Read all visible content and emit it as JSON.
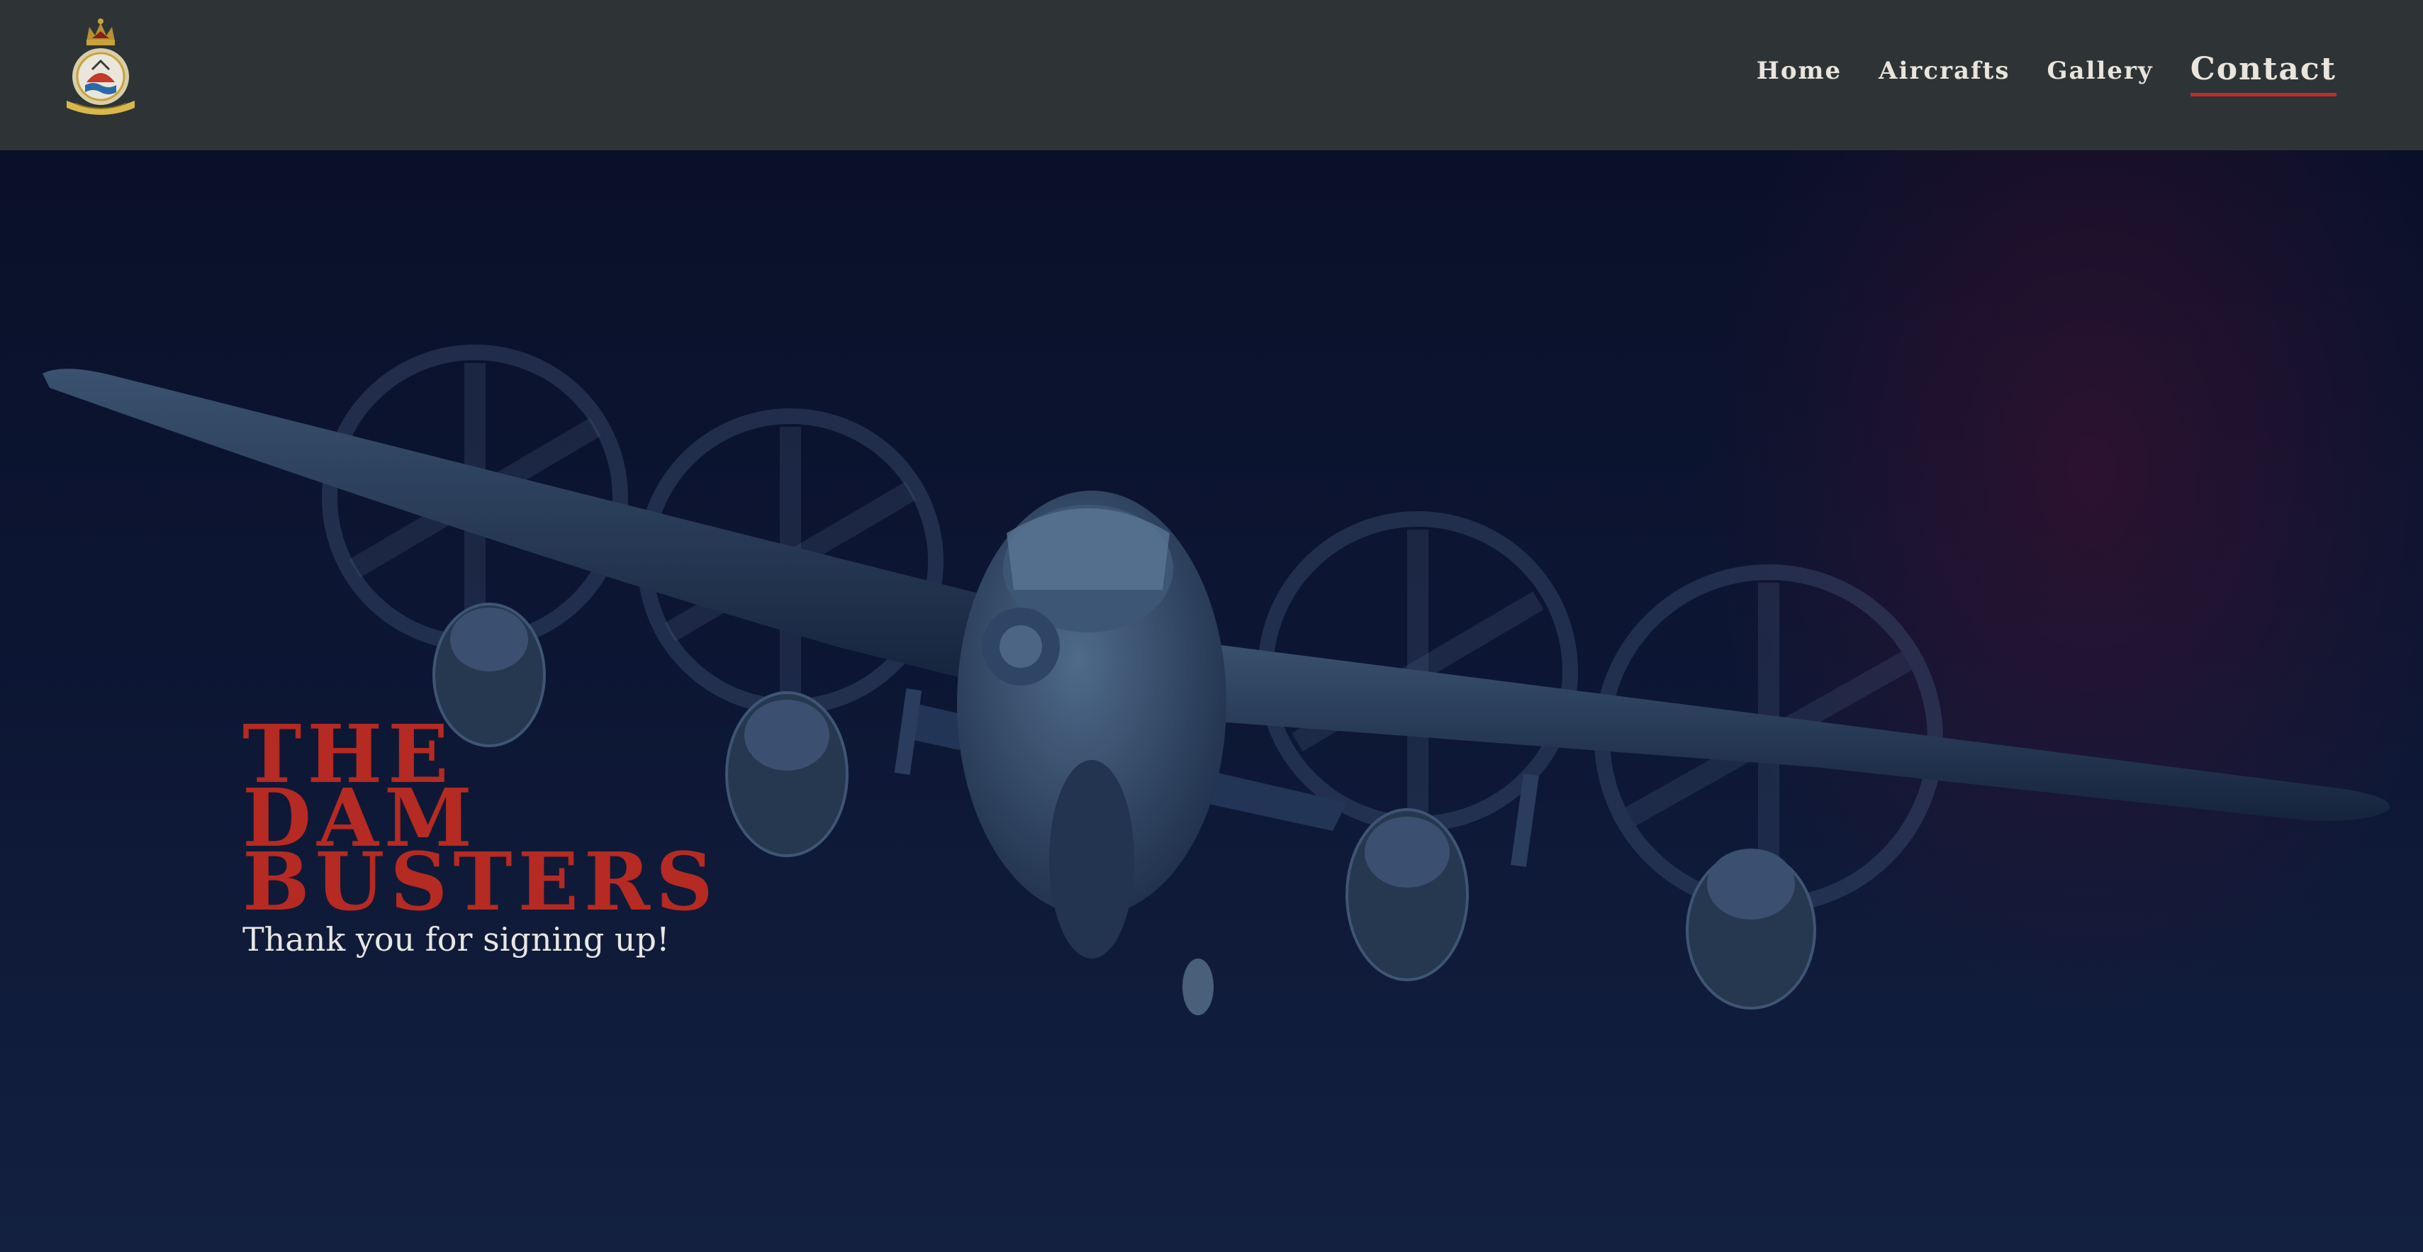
{
  "header": {
    "logo_icon": "squadron-crest-icon"
  },
  "nav": {
    "items": [
      {
        "label": "Home"
      },
      {
        "label": "Aircrafts"
      },
      {
        "label": "Gallery"
      },
      {
        "label": "Contact"
      }
    ],
    "active": "Contact"
  },
  "hero": {
    "title_lines": [
      "THE",
      "DAM",
      "BUSTERS"
    ],
    "subtitle": "Thank you for signing up!",
    "image": "lancaster-bomber-night-image"
  },
  "colors": {
    "header_bg": "#2e3436",
    "nav_text": "#e9e4dc",
    "accent_red": "#b52a22",
    "hero_bg": "#0b1430"
  }
}
